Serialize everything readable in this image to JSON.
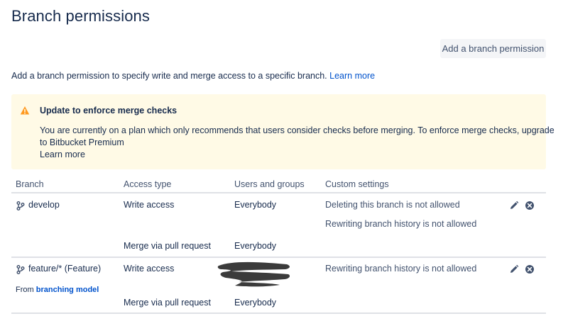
{
  "page": {
    "title": "Branch permissions"
  },
  "toolbar": {
    "add_label": "Add a branch permission"
  },
  "intro": {
    "text": "Add a branch permission to specify write and merge access to a specific branch.",
    "link": "Learn more"
  },
  "notice": {
    "title": "Update to enforce merge checks",
    "line1": "You are currently on a plan which only recommends that users consider checks before merging. To enforce merge checks, upgrade",
    "line2": "to Bitbucket Premium",
    "link": "Learn more",
    "icon": "warning-icon",
    "color": "#fffae6"
  },
  "table": {
    "columns": [
      "Branch",
      "Access type",
      "Users and groups",
      "Custom settings"
    ],
    "rows": [
      {
        "branch": "develop",
        "write_access": "Write access",
        "write_users": "Everybody",
        "merge_access": "Merge via pull request",
        "merge_users": "Everybody",
        "settings": [
          "Deleting this branch is not allowed",
          "Rewriting branch history is not allowed"
        ]
      },
      {
        "branch": "feature/* (Feature)",
        "from_prefix": "From",
        "from_link": "branching model",
        "write_access": "Write access",
        "write_users": "",
        "merge_access": "Merge via pull request",
        "merge_users": "Everybody",
        "settings": [
          "Rewriting branch history is not allowed"
        ]
      }
    ]
  },
  "colors": {
    "link": "#0052cc",
    "text": "#172b4d",
    "muted": "#42526e",
    "divider": "#dfe1e6"
  }
}
